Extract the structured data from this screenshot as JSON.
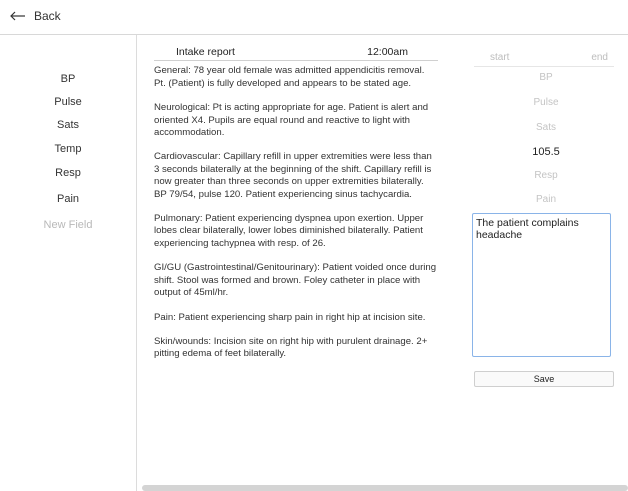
{
  "topbar": {
    "back_label": "Back"
  },
  "sidebar": {
    "items": [
      {
        "label": "BP"
      },
      {
        "label": "Pulse"
      },
      {
        "label": "Sats"
      },
      {
        "label": "Temp"
      },
      {
        "label": "Resp"
      },
      {
        "label": "Pain"
      },
      {
        "label": "New Field"
      }
    ]
  },
  "report": {
    "title": "Intake report",
    "time": "12:00am",
    "paragraphs": [
      "General: 78 year old female was admitted appendicitis removal.  Pt. (Patient) is fully developed and appears to be stated age.",
      "Neurological: Pt is acting appropriate for age. Patient is alert and oriented X4. Pupils are equal round and reactive to light with accommodation.",
      "Cardiovascular: Capillary refill in upper extremities were less than 3 seconds bilaterally at the beginning of the shift. Capillary refill is now greater than three seconds on upper extremities bilaterally. BP 79/54, pulse 120. Patient experiencing sinus tachycardia.",
      "Pulmonary: Patient experiencing dyspnea upon exertion. Upper lobes clear bilaterally, lower lobes diminished bilaterally. Patient experiencing tachypnea with resp. of 26.",
      "GI/GU (Gastrointestinal/Genitourinary): Patient voided once during shift. Stool was formed and brown. Foley catheter in place with output of 45ml/hr.",
      "Pain: Patient experiencing sharp pain in right hip at incision site.",
      "Skin/wounds: Incision site on right hip with purulent drainage. 2+ pitting edema of feet bilaterally."
    ]
  },
  "vitals": {
    "col_start": "start",
    "col_end": "end",
    "fields": [
      {
        "value": "BP",
        "filled": false
      },
      {
        "value": "Pulse",
        "filled": false
      },
      {
        "value": "Sats",
        "filled": false
      },
      {
        "value": "105.5",
        "filled": true
      },
      {
        "value": "Resp",
        "filled": false
      },
      {
        "value": "Pain",
        "filled": false
      }
    ]
  },
  "notes": {
    "value": "The patient complains headache"
  },
  "save_label": "Save",
  "colors": {
    "accent_border": "#8ab4e8",
    "placeholder": "#b8b8b8"
  }
}
